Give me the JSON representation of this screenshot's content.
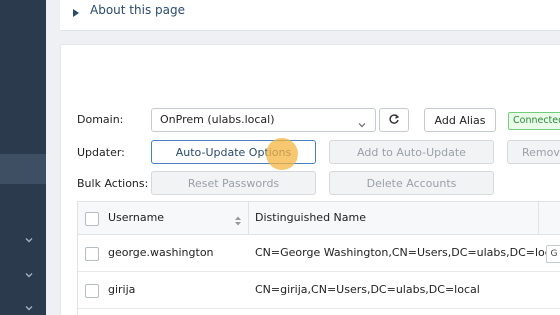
{
  "about": {
    "label": "About this page"
  },
  "form": {
    "domain_label": "Domain:",
    "domain_value": "OnPrem (ulabs.local)",
    "add_alias_label": "Add Alias",
    "connection_status": "Connected",
    "updater_label": "Updater:",
    "auto_update_options_label": "Auto-Update Options",
    "add_to_auto_update_label": "Add to Auto-Update",
    "remove_label": "Remove",
    "bulk_actions_label": "Bulk Actions:",
    "reset_passwords_label": "Reset Passwords",
    "delete_accounts_label": "Delete Accounts"
  },
  "table": {
    "columns": [
      "Username",
      "Distinguished Name"
    ],
    "rows": [
      {
        "username": "george.washington",
        "dn": "CN=George Washington,CN=Users,DC=ulabs,DC=local",
        "action": "G"
      },
      {
        "username": "girija",
        "dn": "CN=girija,CN=Users,DC=ulabs,DC=local"
      }
    ]
  },
  "colors": {
    "sidebar": "#2b3a4c",
    "accent": "#4a7fc1",
    "status_green": "#2b8a3a",
    "cursor_highlight": "#f5b542"
  }
}
